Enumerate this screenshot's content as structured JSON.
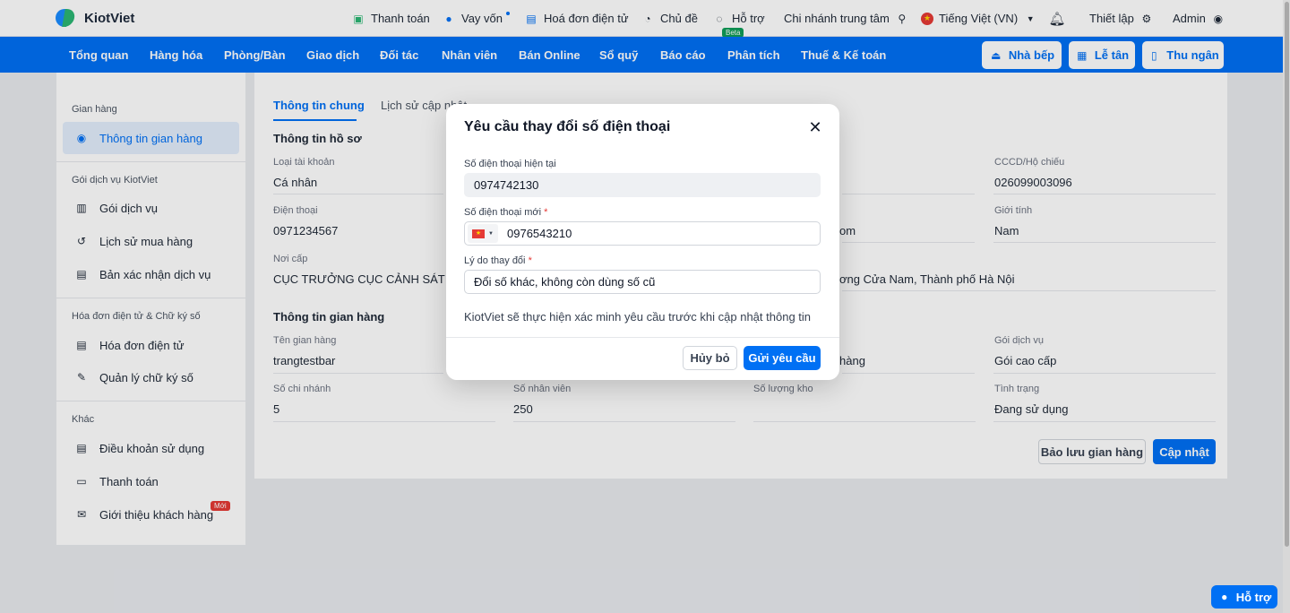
{
  "brand": {
    "name": "KiotViet"
  },
  "topbar": {
    "payment": "Thanh toán",
    "loan": "Vay vốn",
    "einvoice": "Hoá đơn điện tử",
    "theme": "Chủ đề",
    "support": "Hỗ trợ",
    "support_badge": "Beta",
    "branch": "Chi nhánh trung tâm",
    "language": "Tiếng Việt (VN)",
    "settings": "Thiết lập",
    "user": "Admin"
  },
  "nav": {
    "items": [
      "Tổng quan",
      "Hàng hóa",
      "Phòng/Bàn",
      "Giao dịch",
      "Đối tác",
      "Nhân viên",
      "Bán Online",
      "Sổ quỹ",
      "Báo cáo",
      "Phân tích",
      "Thuế & Kế toán"
    ],
    "kitchen": "Nhà bếp",
    "reception": "Lễ tân",
    "cashier": "Thu ngân"
  },
  "sidebar": {
    "group_store": "Gian hàng",
    "store_info": "Thông tin gian hàng",
    "group_service": "Gói dịch vụ KiotViet",
    "service_pack": "Gói dịch vụ",
    "purchase_history": "Lịch sử mua hàng",
    "service_confirm": "Bản xác nhận dịch vụ",
    "group_invoice": "Hóa đơn điện tử & Chữ ký số",
    "einvoice": "Hóa đơn điện tử",
    "signature": "Quản lý chữ ký số",
    "group_other": "Khác",
    "terms": "Điều khoản sử dụng",
    "payment": "Thanh toán",
    "referral": "Giới thiệu khách hàng",
    "new_badge": "Mới"
  },
  "main": {
    "tab_general": "Thông tin chung",
    "tab_history": "Lịch sử cập nhật",
    "profile_title": "Thông tin hồ sơ",
    "account_type_label": "Loại tài khoản",
    "account_type": "Cá nhân",
    "id_label": "CCCD/Hộ chiếu",
    "id_value": "026099003096",
    "phone_label": "Điện thoại",
    "phone_value": "0971234567",
    "email_partial": "om",
    "gender_label": "Giới tính",
    "gender_value": "Nam",
    "issued_label": "Nơi cấp",
    "issued_value": "CỤC TRƯỞNG CỤC CẢNH SÁT QU",
    "address_partial": "ơng Cửa Nam, Thành phố Hà Nội",
    "store_title": "Thông tin gian hàng",
    "store_name_label": "Tên gian hàng",
    "store_name": "trangtestbar",
    "industry_partial": "hàng",
    "service_label": "Gói dịch vụ",
    "service_value": "Gói cao cấp",
    "branches_label": "Số chi nhánh",
    "branches_value": "5",
    "staff_label": "Số nhân viên",
    "staff_value": "250",
    "warehouses_label": "Số lượng kho",
    "status_label": "Tình trạng",
    "status_value": "Đang sử dụng",
    "save_store": "Bảo lưu gian hàng",
    "update": "Cập nhật"
  },
  "modal": {
    "title": "Yêu cầu thay đổi số điện thoại",
    "current_label": "Số điện thoại hiện tại",
    "current_value": "0974742130",
    "new_label": "Số điện thoại mới",
    "required_mark": "*",
    "new_value": "0976543210",
    "reason_label": "Lý do thay đổi",
    "reason_value": "Đổi số khác, không còn dùng số cũ",
    "note": "KiotViet sẽ thực hiện xác minh yêu cầu trước khi cập nhật thông tin",
    "cancel": "Hủy bỏ",
    "submit": "Gửi yêu cầu"
  },
  "help_float": "Hỗ trợ",
  "colors": {
    "primary": "#0070f4",
    "accent_green": "#2bb673",
    "danger": "#e53935"
  }
}
